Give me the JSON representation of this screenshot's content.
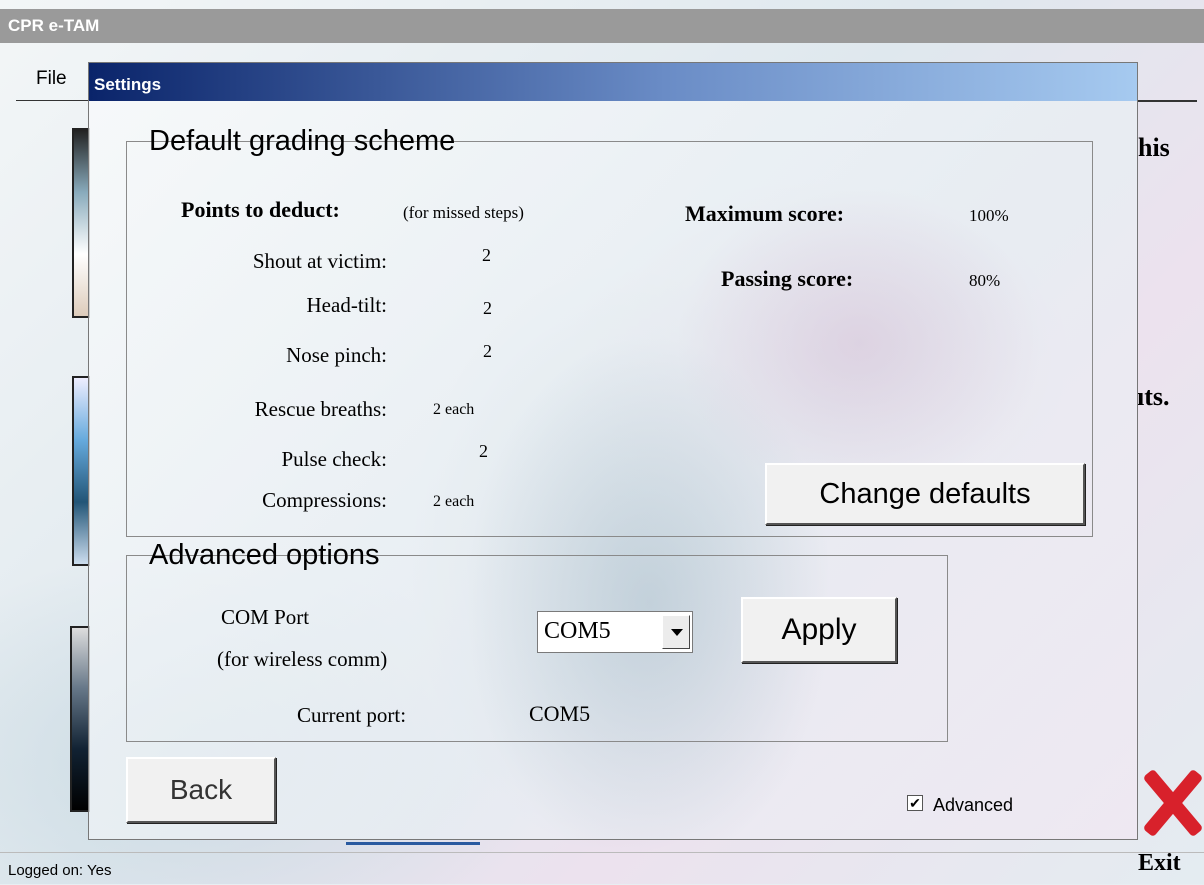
{
  "app": {
    "title": "CPR e-TAM",
    "menu": {
      "file": "File"
    },
    "background_fragments": {
      "right_top": "his",
      "right_mid": "ıts."
    },
    "exit_label": "Exit",
    "status": "Logged on: Yes"
  },
  "dialog": {
    "title": "Settings",
    "grading": {
      "legend": "Default grading scheme",
      "points_heading": "Points to deduct:",
      "points_note": "(for missed steps)",
      "steps": [
        {
          "label": "Shout at victim:",
          "value": "2"
        },
        {
          "label": "Head-tilt:",
          "value": "2"
        },
        {
          "label": "Nose pinch:",
          "value": "2"
        },
        {
          "label": "Rescue breaths:",
          "value": "2 each"
        },
        {
          "label": "Pulse check:",
          "value": "2"
        },
        {
          "label": "Compressions:",
          "value": "2 each"
        }
      ],
      "max_score_label": "Maximum score:",
      "max_score_value": "100%",
      "pass_score_label": "Passing score:",
      "pass_score_value": "80%",
      "change_defaults": "Change defaults"
    },
    "advanced": {
      "legend": "Advanced options",
      "com_label_line1": "COM Port",
      "com_label_line2": "(for wireless comm)",
      "com_selected": "COM5",
      "apply": "Apply",
      "current_port_label": "Current port:",
      "current_port_value": "COM5"
    },
    "back": "Back",
    "advanced_checkbox": {
      "label": "Advanced",
      "checked": true
    }
  }
}
